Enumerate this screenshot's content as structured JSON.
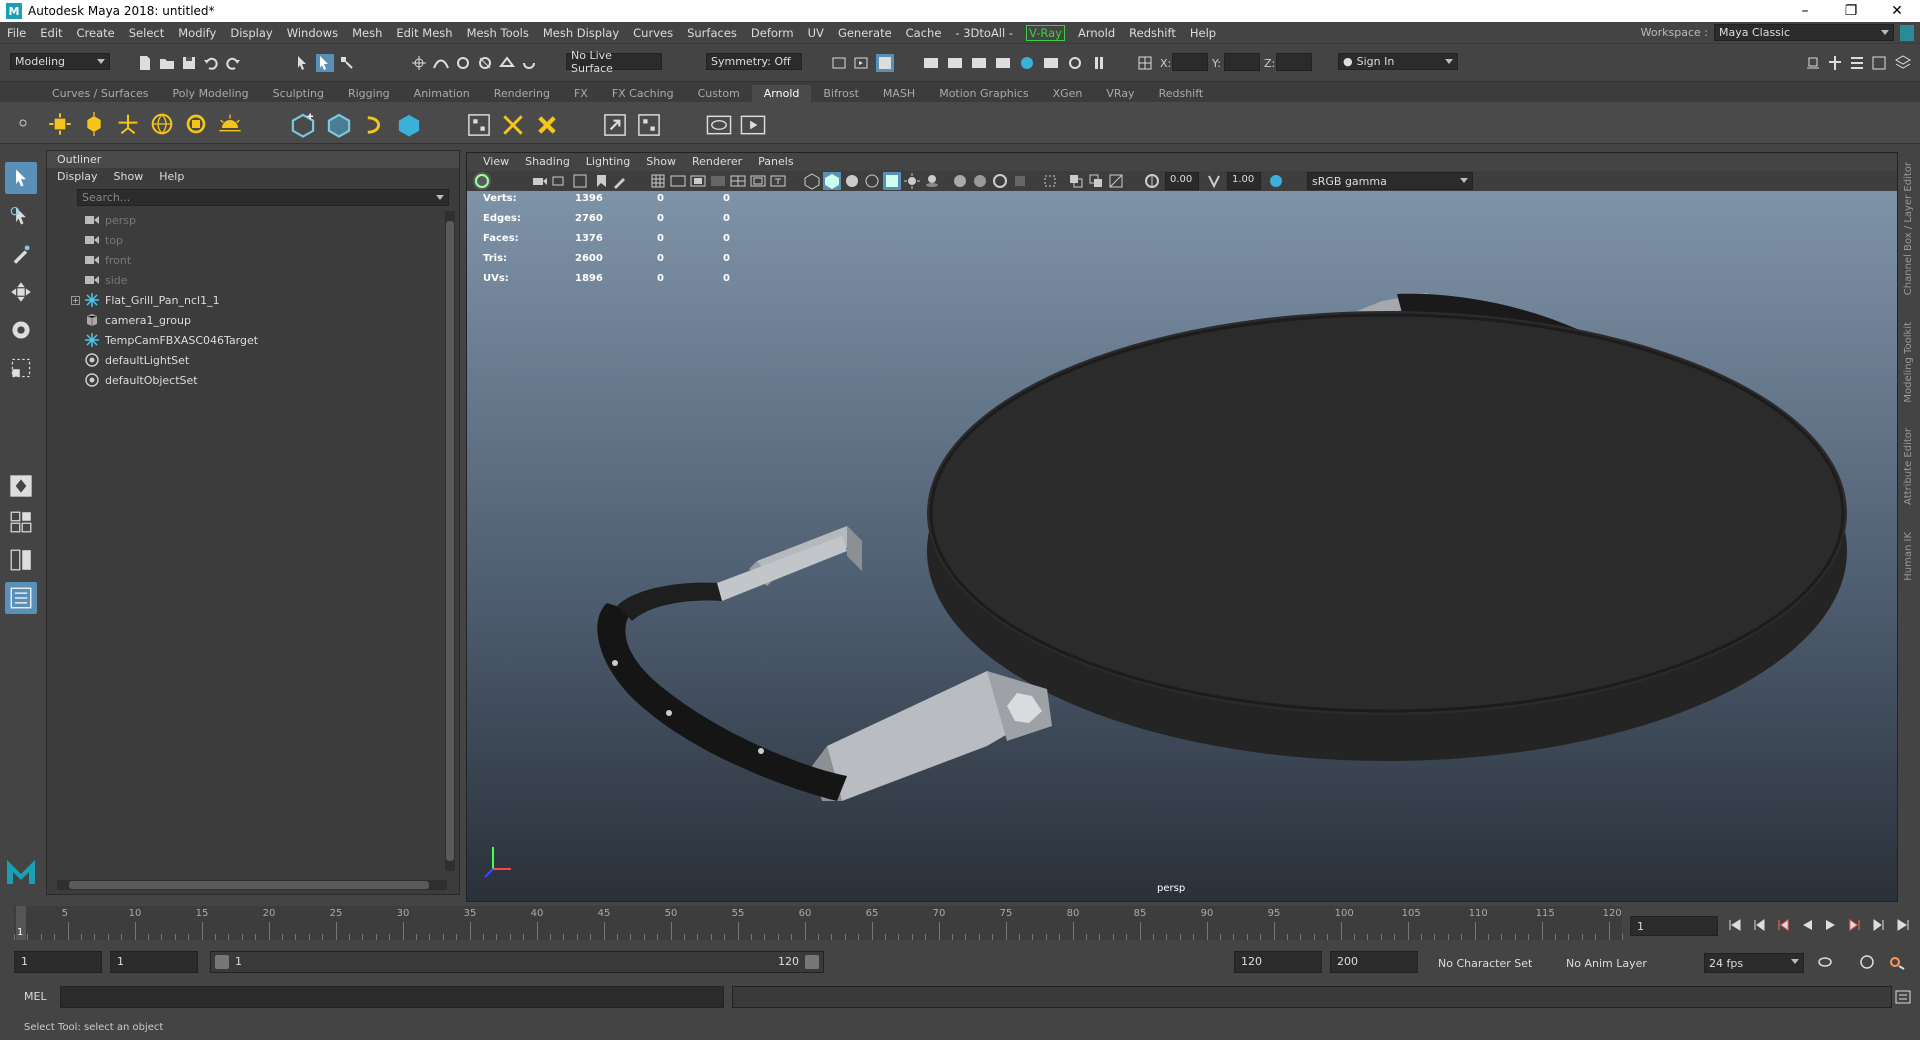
{
  "window": {
    "title": "Autodesk Maya 2018: untitled*",
    "logo": "M"
  },
  "menubar": {
    "items": [
      "File",
      "Edit",
      "Create",
      "Select",
      "Modify",
      "Display",
      "Windows",
      "Mesh",
      "Edit Mesh",
      "Mesh Tools",
      "Mesh Display",
      "Curves",
      "Surfaces",
      "Deform",
      "UV",
      "Generate",
      "Cache",
      "- 3DtoAll -"
    ],
    "vray": "V-Ray",
    "items2": [
      "Arnold",
      "Redshift",
      "Help"
    ],
    "workspace_label": "Workspace :",
    "workspace_value": "Maya Classic"
  },
  "statusline": {
    "mode": "Modeling",
    "live_surface": "No Live Surface",
    "symmetry": "Symmetry: Off",
    "x_label": "X:",
    "y_label": "Y:",
    "z_label": "Z:",
    "sign_in": "Sign In"
  },
  "shelf": {
    "tabs": [
      "Curves / Surfaces",
      "Poly Modeling",
      "Sculpting",
      "Rigging",
      "Animation",
      "Rendering",
      "FX",
      "FX Caching",
      "Custom",
      "Arnold",
      "Bifrost",
      "MASH",
      "Motion Graphics",
      "XGen",
      "VRay",
      "Redshift"
    ],
    "active_tab": "Arnold"
  },
  "outliner": {
    "title": "Outliner",
    "menus": [
      "Display",
      "Show",
      "Help"
    ],
    "search_placeholder": "Search...",
    "items": [
      {
        "label": "persp",
        "icon": "camera-icon",
        "dim": true
      },
      {
        "label": "top",
        "icon": "camera-icon",
        "dim": true
      },
      {
        "label": "front",
        "icon": "camera-icon",
        "dim": true
      },
      {
        "label": "side",
        "icon": "camera-icon",
        "dim": true
      },
      {
        "label": "Flat_Grill_Pan_ncl1_1",
        "icon": "locator-icon",
        "dim": false,
        "expandable": true
      },
      {
        "label": "camera1_group",
        "icon": "group-icon",
        "dim": false
      },
      {
        "label": "TempCamFBXASC046Target",
        "icon": "locator-icon",
        "dim": false
      },
      {
        "label": "defaultLightSet",
        "icon": "set-icon",
        "dim": false
      },
      {
        "label": "defaultObjectSet",
        "icon": "set-icon",
        "dim": false
      }
    ]
  },
  "viewport": {
    "menus": [
      "View",
      "Shading",
      "Lighting",
      "Show",
      "Renderer",
      "Panels"
    ],
    "exposure": "0.00",
    "gamma": "1.00",
    "color_space": "sRGB gamma",
    "camera_label": "persp",
    "hud": [
      {
        "label": "Verts:",
        "v1": "1396",
        "v2": "0",
        "v3": "0"
      },
      {
        "label": "Edges:",
        "v1": "2760",
        "v2": "0",
        "v3": "0"
      },
      {
        "label": "Faces:",
        "v1": "1376",
        "v2": "0",
        "v3": "0"
      },
      {
        "label": "Tris:",
        "v1": "2600",
        "v2": "0",
        "v3": "0"
      },
      {
        "label": "UVs:",
        "v1": "1896",
        "v2": "0",
        "v3": "0"
      }
    ]
  },
  "right_tabs": [
    "Channel Box / Layer Editor",
    "Modeling Toolkit",
    "Attribute Editor",
    "Human IK"
  ],
  "timeline": {
    "ticks": [
      "5",
      "10",
      "15",
      "20",
      "25",
      "30",
      "35",
      "40",
      "45",
      "50",
      "55",
      "60",
      "65",
      "70",
      "75",
      "80",
      "85",
      "90",
      "95",
      "100",
      "105",
      "110",
      "115",
      "120"
    ],
    "current_frame_marker": "1",
    "current_frame": "1"
  },
  "range": {
    "start": "1",
    "playback_start": "1",
    "slider_start": "1",
    "slider_end": "120",
    "playback_end": "120",
    "end": "200",
    "character_set": "No Character Set",
    "anim_layer": "No Anim Layer",
    "fps": "24 fps"
  },
  "command": {
    "label": "MEL"
  },
  "help_line": "Select Tool: select an object"
}
